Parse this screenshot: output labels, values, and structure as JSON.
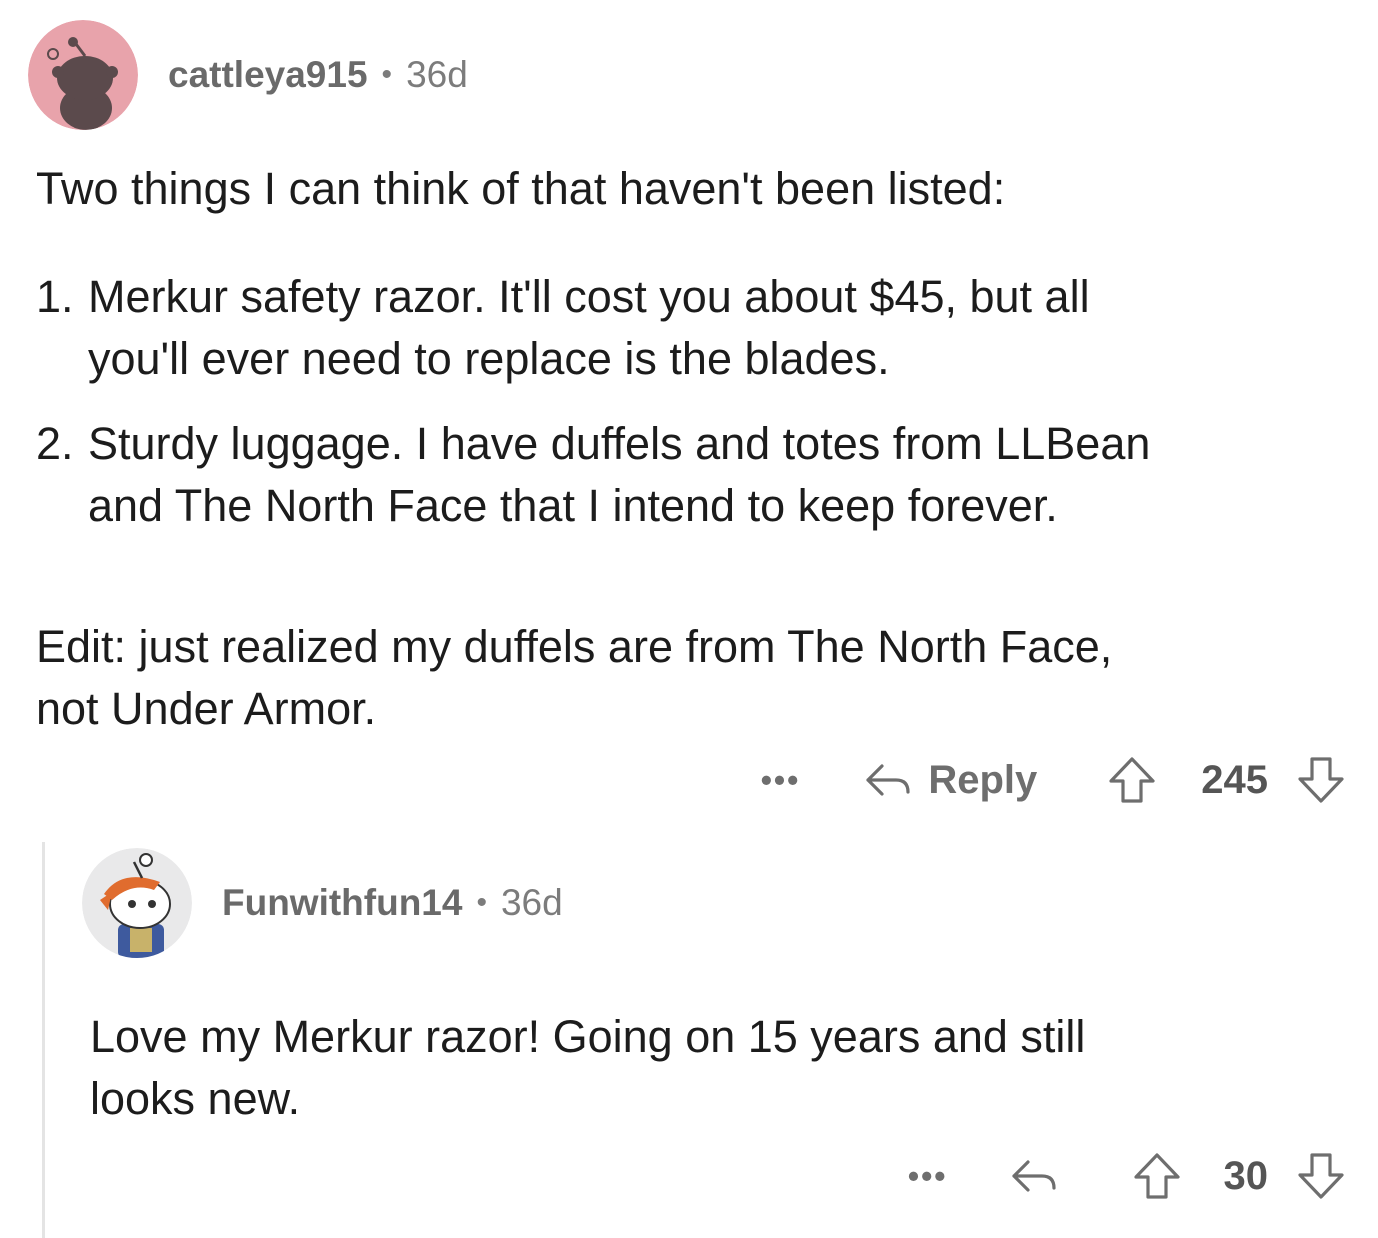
{
  "comment1": {
    "username": "cattleya915",
    "age": "36d",
    "intro": "Two things I can think of that haven't been listed:",
    "items": [
      {
        "num": "1.",
        "line1": "Merkur safety razor. It'll cost you about $45, but all",
        "line2": "you'll ever need to replace is the blades."
      },
      {
        "num": "2.",
        "line1": "Sturdy luggage. I have duffels and totes from LLBean",
        "line2": "and The North Face that I intend to keep forever."
      }
    ],
    "edit_line1": "Edit: just realized my duffels are from The North Face,",
    "edit_line2": "not Under Armor.",
    "more_label": "•••",
    "reply_label": "Reply",
    "score": "245"
  },
  "comment2": {
    "username": "Funwithfun14",
    "age": "36d",
    "line1": "Love my Merkur razor!  Going on 15 years and still",
    "line2": "looks new.",
    "more_label": "•••",
    "score": "30"
  },
  "separator": "•",
  "colors": {
    "avatar1_bg": "#e8a3ab",
    "avatar2_bg": "#e9e9ea",
    "meta_text": "#7c7c7c",
    "icon_stroke": "#6e6e6e"
  }
}
